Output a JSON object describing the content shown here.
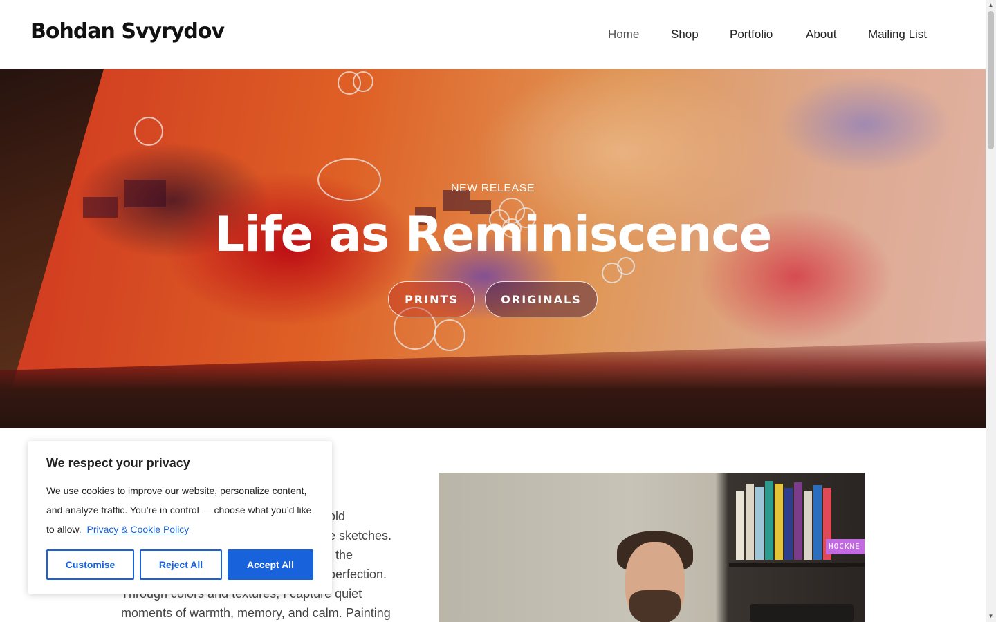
{
  "header": {
    "logo": "Bohdan Svyrydov",
    "nav": [
      "Home",
      "Shop",
      "Portfolio",
      "About",
      "Mailing List"
    ]
  },
  "hero": {
    "eyebrow": "NEW RELEASE",
    "title": "Life as Reminiscence",
    "buttons": [
      "PRINTS",
      "ORIGINALS"
    ]
  },
  "intro": {
    "lines": [
      "old",
      "e sketches.",
      ", the",
      "perfection.",
      "Through colors and textures, I capture quiet",
      "moments of warmth, memory, and calm. Painting"
    ]
  },
  "portrait": {
    "book_label": "HOCKNE"
  },
  "cookie": {
    "title": "We respect your privacy",
    "text": "We use cookies to improve our website, personalize content, and analyze traffic. You’re in control — choose what you’d like to allow.",
    "link": "Privacy & Cookie Policy",
    "buttons": {
      "customise": "Customise",
      "reject": "Reject All",
      "accept": "Accept All"
    }
  },
  "colors": {
    "accent": "#1863dc",
    "text": "#212121"
  }
}
